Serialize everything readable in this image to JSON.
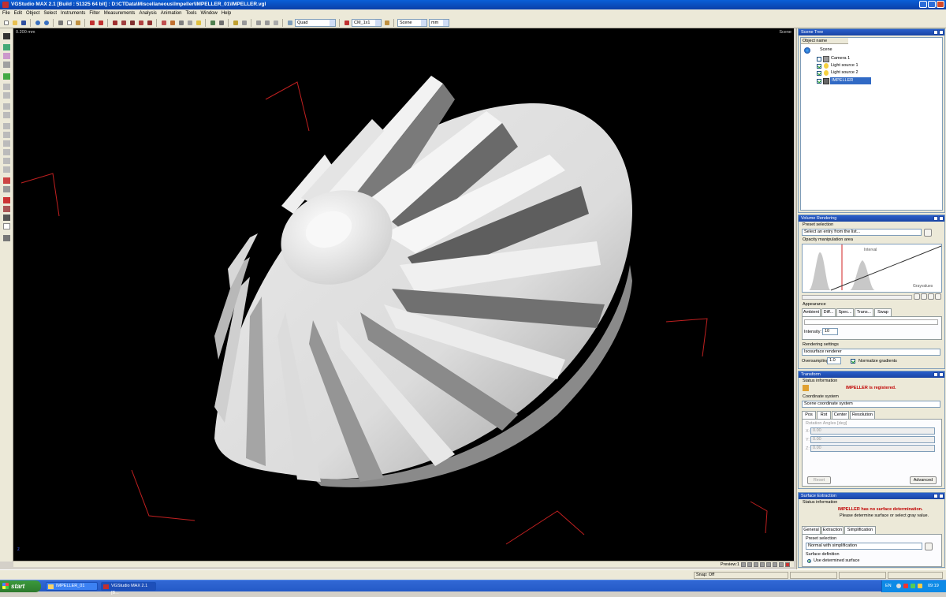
{
  "window": {
    "title": "VGStudio MAX 2.1  [Build : 51325   64 bit]  :  D:\\CTData\\Miscellaneous\\Impeller\\IMPELLER_01\\IMPELLER.vgl"
  },
  "menu": [
    "File",
    "Edit",
    "Object",
    "Select",
    "Instruments",
    "Filter",
    "Measurements",
    "Analysis",
    "Animation",
    "Tools",
    "Window",
    "Help"
  ],
  "toolbar": {
    "layout_combo": "Quad",
    "cm_combo": "CM_1x1",
    "scene_combo": "Scene",
    "unit_combo": "mm"
  },
  "viewport": {
    "scale_label": "0.200 mm",
    "name": "Scene",
    "preview_label": "Preview:1"
  },
  "scene_tree": {
    "title": "Scene Tree",
    "column": "Object name",
    "items": [
      {
        "label": "Scene",
        "checked": false
      },
      {
        "label": "Camera 1",
        "checked": false
      },
      {
        "label": "Light source 1",
        "checked": true
      },
      {
        "label": "Light source 2",
        "checked": true
      },
      {
        "label": "IMPELLER",
        "checked": true,
        "selected": true
      }
    ]
  },
  "volume_rendering": {
    "title": "Volume Rendering",
    "preset_label": "Preset selection",
    "preset_placeholder": "Select an entry from the list...",
    "opacity_label": "Opacity manipulation area",
    "interval_label": "Interval",
    "grayvalues_label": "Grayvalues",
    "appearance_label": "Appearance",
    "tabs": [
      "Ambient",
      "Diff...",
      "Spec...",
      "Trans...",
      "Swap"
    ],
    "intensity_label": "Intensity:",
    "intensity_value": "10",
    "rendering_label": "Rendering settings",
    "renderer": "Isosurface renderer",
    "oversampling_label": "Oversampling:",
    "oversampling_value": "1.0",
    "normalize_label": "Normalize gradients"
  },
  "transform": {
    "title": "Transform",
    "status_label": "Status information",
    "status_text": "IMPELLER is registered.",
    "coord_label": "Coordinate system",
    "coord_value": "Scene coordinate system",
    "tabs": [
      "Pos",
      "Rot",
      "Center",
      "Resolution"
    ],
    "rotation_label": "Rotation Angles [deg]",
    "x_label": "X:",
    "x_value": "0.00",
    "y_label": "Y:",
    "y_value": "0.00",
    "z_label": "Z:",
    "z_value": "0.00",
    "reset_label": "Reset",
    "advanced_label": "Advanced"
  },
  "surface_extraction": {
    "title": "Surface Extraction",
    "status_label": "Status information",
    "status_line1": "IMPELLER has no surface determination.",
    "status_line2": "Please determine surface or select gray value.",
    "tabs": [
      "General",
      "Extraction",
      "Simplification"
    ],
    "preset_label": "Preset selection",
    "preset_value": "Normal with simplification",
    "surface_label": "Surface definition",
    "use_label": "Use determined surface"
  },
  "statusbar": {
    "snap": "Snap: Off"
  },
  "taskbar": {
    "start": "start",
    "tasks": [
      "IMPELLER_01",
      "VGStudio MAX 2.1  [B..."
    ],
    "lang": "EN",
    "clock": "09:19"
  }
}
